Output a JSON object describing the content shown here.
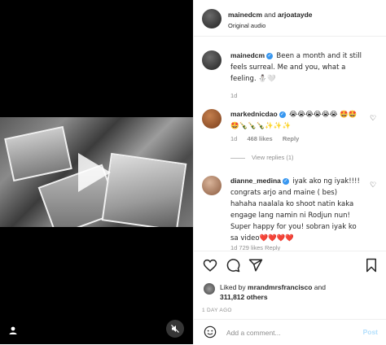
{
  "header": {
    "user1": "mainedcm",
    "and": "and",
    "user2": "arjoatayde",
    "audio": "Original audio"
  },
  "comments": [
    {
      "user": "mainedcm",
      "verified": true,
      "text": "Been a month and it still feels surreal. Me and you, what a feeling. ⛄🤍",
      "time": "1d"
    },
    {
      "user": "markednicdao",
      "verified": true,
      "text": "😭😭😭😭😭😭 🤩🤩🤩🍾🍾🍾✨✨✨",
      "time": "1d",
      "likes": "468 likes",
      "reply": "Reply",
      "view_replies": "View replies (1)"
    },
    {
      "user": "dianne_medina",
      "verified": true,
      "text": "iyak ako ng iyak!!!! congrats arjo and maine ( bes) hahaha naalala ko shoot natin kaka engage lang namin ni Rodjun nun! Super happy for you! sobran iyak ko sa video❤️❤️❤️❤️",
      "meta_partial": "1d  729 likes  Reply"
    }
  ],
  "likes": {
    "liked_by": "Liked by",
    "user": "mrandmrsfrancisco",
    "and": "and",
    "count": "311,812 others"
  },
  "time_ago": "1 DAY AGO",
  "add_comment": {
    "placeholder": "Add a comment...",
    "post": "Post"
  },
  "colors": {
    "verified": "#3897f0",
    "post_disabled": "#b2dffc",
    "muted_text": "#8e8e8e"
  }
}
